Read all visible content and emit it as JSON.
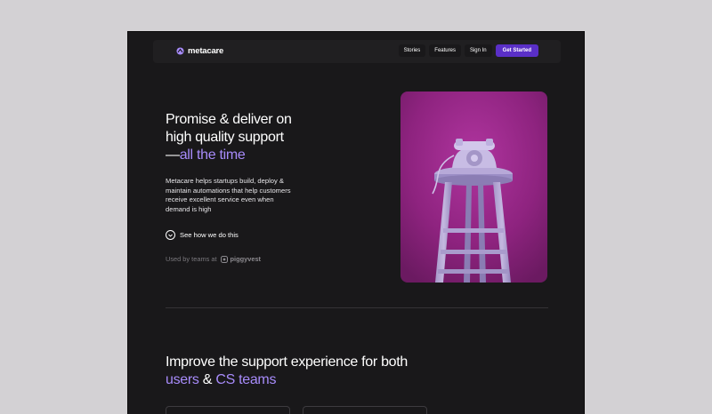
{
  "brand": {
    "name": "metacare",
    "accent": "#5a2fc7",
    "accent_light": "#a78bfa"
  },
  "nav": {
    "links": [
      "Stories",
      "Features",
      "Sign In"
    ],
    "cta": "Get Started"
  },
  "hero": {
    "title_line1": "Promise & deliver on",
    "title_line2": "high quality support",
    "title_prefix": "—",
    "title_accent": "all the time",
    "description": "Metacare helps startups build, deploy & maintain automations that help customers receive excellent service even when demand is high",
    "see_how": "See how we do this",
    "used_by": "Used by teams at",
    "partner": "piggyvest"
  },
  "section": {
    "title_line1": "Improve the support experience for both",
    "accent1": "users",
    "connector": " & ",
    "accent2": "CS teams"
  },
  "icons": {
    "logo": "metacare-logo-icon",
    "chevron": "chevron-down-icon",
    "partner": "piggyvest-logo-icon"
  }
}
